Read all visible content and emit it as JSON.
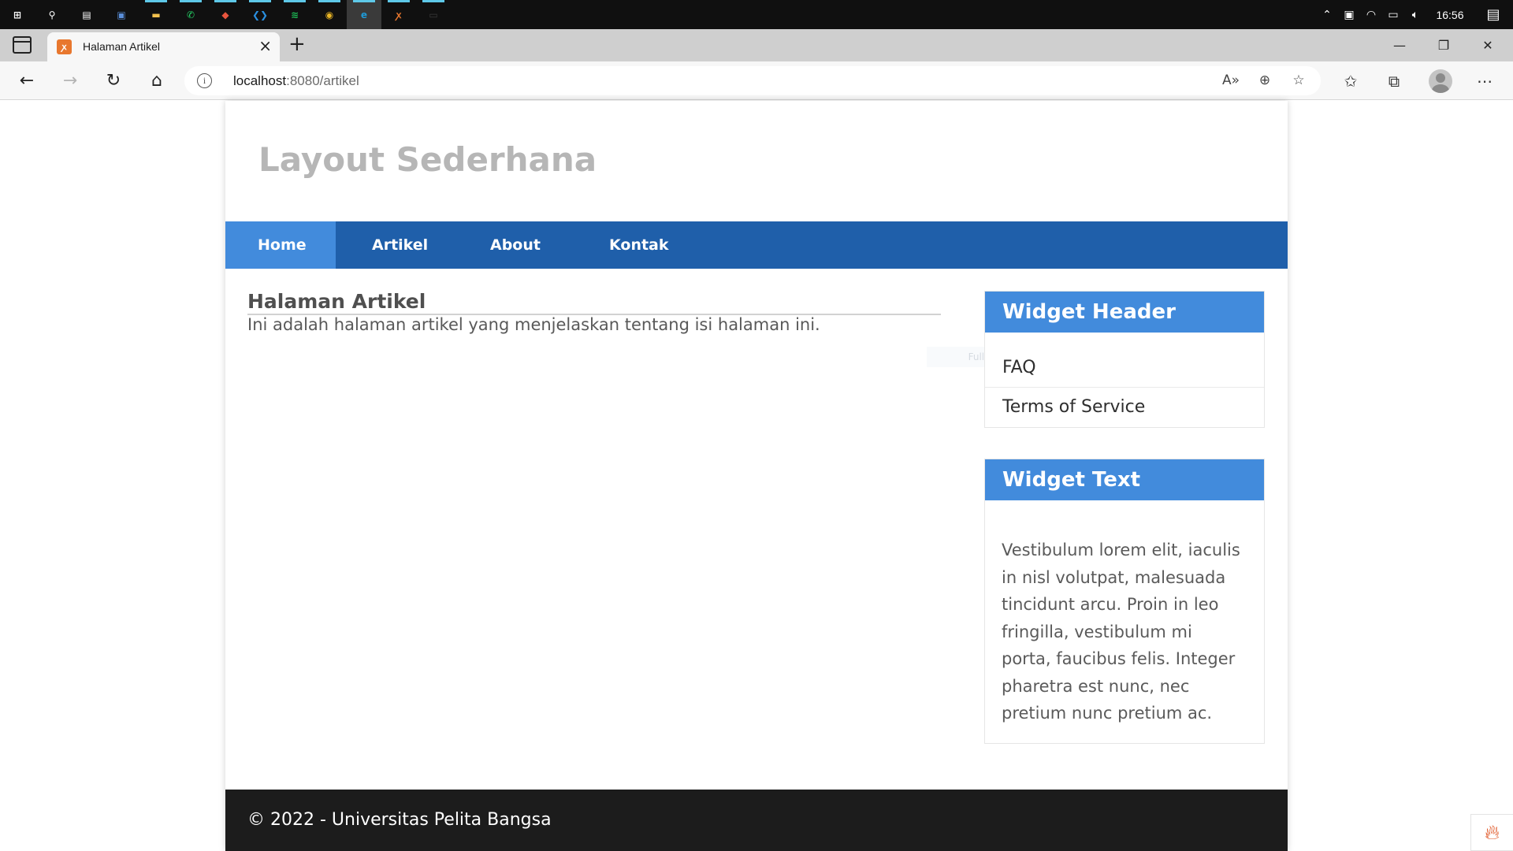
{
  "taskbar": {
    "apps": [
      {
        "icon": "windows-start-icon",
        "label": "⊞",
        "color": "#ffffff"
      },
      {
        "icon": "search-icon",
        "label": "⚲",
        "color": "#ffffff"
      },
      {
        "icon": "task-view-icon",
        "label": "▤",
        "color": "#ffffff"
      },
      {
        "icon": "photos-app-icon",
        "label": "▣",
        "color": "#5a8ed8"
      },
      {
        "icon": "file-explorer-icon",
        "label": "▬",
        "color": "#f2c14e"
      },
      {
        "icon": "whatsapp-icon",
        "label": "✆",
        "color": "#25d366"
      },
      {
        "icon": "paint-app-icon",
        "label": "◆",
        "color": "#e8553e"
      },
      {
        "icon": "vscode-icon",
        "label": "❮❯",
        "color": "#2a8fe0"
      },
      {
        "icon": "spotify-icon",
        "label": "≋",
        "color": "#1db954"
      },
      {
        "icon": "chrome-icon",
        "label": "◉",
        "color": "#e9b525"
      },
      {
        "icon": "edge-icon",
        "label": "e",
        "color": "#1f9ad6"
      },
      {
        "icon": "xampp-icon",
        "label": "ꭗ",
        "color": "#e8772e"
      },
      {
        "icon": "terminal-icon",
        "label": "▭",
        "color": "#3b3b3b"
      }
    ],
    "clock": "16:56"
  },
  "browser": {
    "tab_title": "Halaman Artikel",
    "tab_close": "×",
    "new_tab": "+",
    "url_host": "localhost",
    "url_rest": ":8080/artikel",
    "window_minimize": "—",
    "window_restore": "❐",
    "window_close": "✕"
  },
  "site": {
    "title": "Layout Sederhana",
    "nav": [
      {
        "label": "Home",
        "active": true
      },
      {
        "label": "Artikel",
        "active": false
      },
      {
        "label": "About",
        "active": false
      },
      {
        "label": "Kontak",
        "active": false
      }
    ],
    "article": {
      "title": "Halaman Artikel",
      "body": "Ini adalah halaman artikel yang menjelaskan tentang isi halaman ini."
    },
    "ghost_tooltip": "Full-screen Snip",
    "widgets": {
      "header": {
        "title": "Widget Header",
        "links": [
          "FAQ",
          "Terms of Service"
        ]
      },
      "text": {
        "title": "Widget Text",
        "body": "Vestibulum lorem elit, iaculis in nisl volutpat, malesuada tincidunt arcu. Proin in leo fringilla, vestibulum mi porta, faucibus felis. Integer pharetra est nunc, nec pretium nunc pretium ac."
      }
    },
    "footer": "© 2022 - Universitas Pelita Bangsa"
  },
  "colors": {
    "nav_bg": "#1f5faa",
    "nav_active": "#428bdc",
    "widget_head": "#428bdc",
    "footer_bg": "#1c1c1c",
    "title_gray": "#b6b6b6"
  }
}
